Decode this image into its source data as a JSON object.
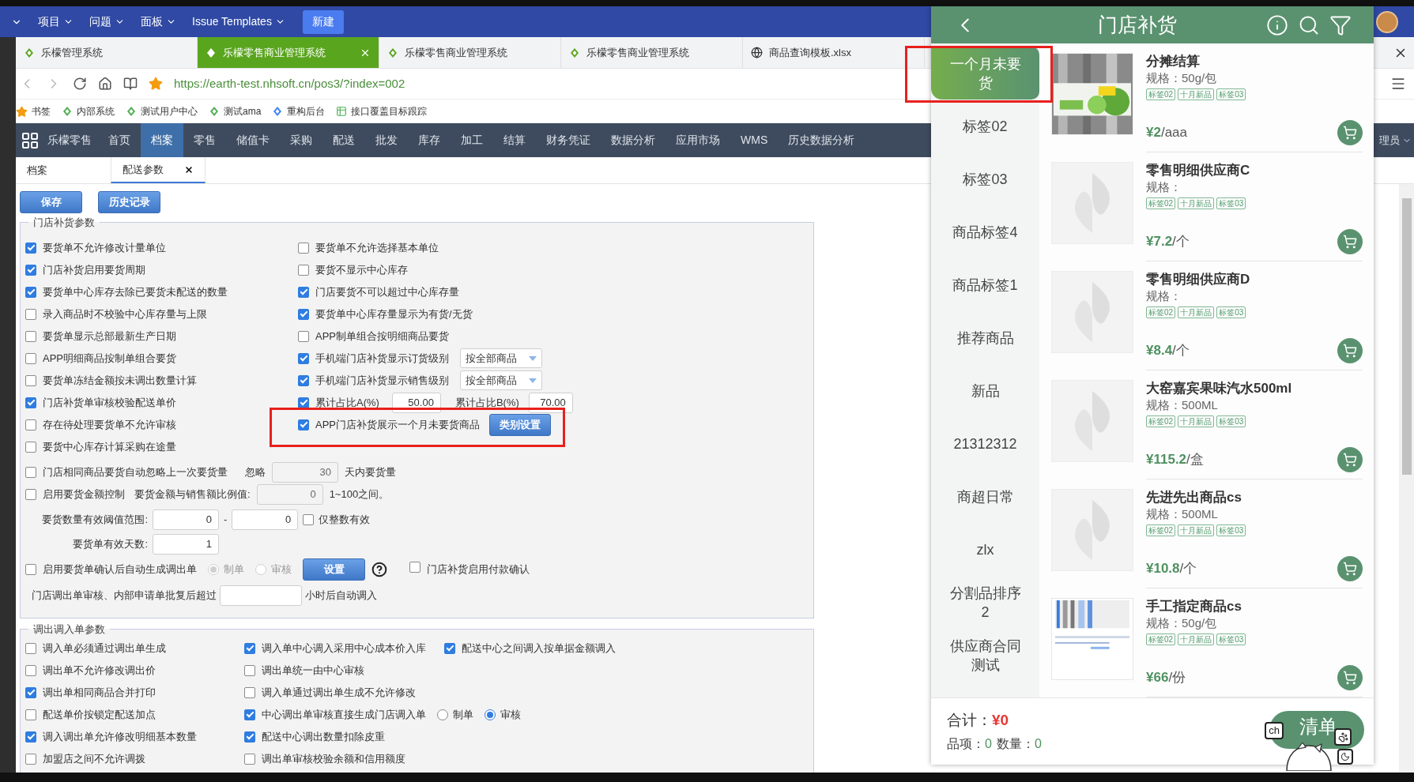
{
  "top_bar": {
    "menus": [
      {
        "label": "项目"
      },
      {
        "label": "问题"
      },
      {
        "label": "面板"
      },
      {
        "label": "Issue Templates"
      }
    ],
    "new_button": "新建"
  },
  "browser_tabs": [
    {
      "title": "乐檬管理系统",
      "selected": false
    },
    {
      "title": "乐檬零售商业管理系统",
      "selected": true
    },
    {
      "title": "乐檬零售商业管理系统",
      "selected": false
    },
    {
      "title": "乐檬零售商业管理系统",
      "selected": false
    },
    {
      "title": "商品查询模板.xlsx",
      "selected": false
    }
  ],
  "address_bar": {
    "url": "https://earth-test.nhsoft.cn/pos3/?index=002"
  },
  "bookmarks": [
    {
      "label": "书签"
    },
    {
      "label": "内部系统"
    },
    {
      "label": "测试用户中心"
    },
    {
      "label": "测试ama"
    },
    {
      "label": "重构后台"
    },
    {
      "label": "接口覆盖目标跟踪"
    }
  ],
  "nav": {
    "brand": "乐檬零售",
    "user": "理员",
    "items": [
      {
        "label": "首页",
        "selected": false
      },
      {
        "label": "档案",
        "selected": true
      },
      {
        "label": "零售",
        "selected": false
      },
      {
        "label": "储值卡",
        "selected": false
      },
      {
        "label": "采购",
        "selected": false
      },
      {
        "label": "配送",
        "selected": false
      },
      {
        "label": "批发",
        "selected": false
      },
      {
        "label": "库存",
        "selected": false
      },
      {
        "label": "加工",
        "selected": false
      },
      {
        "label": "结算",
        "selected": false
      },
      {
        "label": "财务凭证",
        "selected": false
      },
      {
        "label": "数据分析",
        "selected": false
      },
      {
        "label": "应用市场",
        "selected": false
      },
      {
        "label": "WMS",
        "selected": false
      },
      {
        "label": "历史数据分析",
        "selected": false
      }
    ]
  },
  "page_tabs": [
    {
      "label": "档案",
      "selected": false,
      "closable": false
    },
    {
      "label": "配送参数",
      "selected": true,
      "closable": true
    }
  ],
  "actions": [
    "保存",
    "历史记录"
  ],
  "replenish": {
    "title": "门店补货参数",
    "left": [
      {
        "label": "要货单不允许修改计量单位",
        "checked": true
      },
      {
        "label": "门店补货启用要货周期",
        "checked": true
      },
      {
        "label": "要货单中心库存去除已要货未配送的数量",
        "checked": true
      },
      {
        "label": "录入商品时不校验中心库存量与上限",
        "checked": false
      },
      {
        "label": "要货单显示总部最新生产日期",
        "checked": false
      },
      {
        "label": "APP明细商品按制单组合要货",
        "checked": false
      },
      {
        "label": "要货单冻结金额按未调出数量计算",
        "checked": false
      },
      {
        "label": "门店补货单审核校验配送单价",
        "checked": true
      },
      {
        "label": "存在待处理要货单不允许审核",
        "checked": false
      },
      {
        "label": "要货中心库存计算采购在途量",
        "checked": false
      }
    ],
    "right": [
      {
        "kind": "check",
        "label": "要货单不允许选择基本单位",
        "checked": false
      },
      {
        "kind": "check",
        "label": "要货不显示中心库存",
        "checked": false
      },
      {
        "kind": "check",
        "label": "门店要货不可以超过中心库存量",
        "checked": true
      },
      {
        "kind": "check",
        "label": "要货单中心库存量显示为有货/无货",
        "checked": true
      },
      {
        "kind": "check",
        "label": "APP制单组合按明细商品要货",
        "checked": false
      },
      {
        "kind": "select",
        "label": "手机端门店补货显示订货级别",
        "checked": true,
        "value": "按全部商品"
      },
      {
        "kind": "select",
        "label": "手机端门店补货显示销售级别",
        "checked": true,
        "value": "按全部商品"
      },
      {
        "kind": "ratio",
        "label": "累计占比A(%)",
        "checked": true,
        "value": "50.00",
        "label2": "累计占比B(%)",
        "value2": "70.00"
      },
      {
        "kind": "button",
        "label": "APP门店补货展示一个月未要货商品",
        "checked": true,
        "button": "类别设置",
        "highlighted": true
      }
    ],
    "ignore_row": {
      "label": "门店相同商品要货自动忽略上一次要货量",
      "checked": false,
      "prefix": "忽略",
      "value": "30",
      "suffix": "天内要货量"
    },
    "amount_row": {
      "label": "启用要货金额控制",
      "checked": false,
      "ratio_label": "要货金额与销售额比例值:",
      "value": "0",
      "suffix": "1~100之间。"
    },
    "threshold_row": {
      "label": "要货数量有效阈值范围:",
      "min": "0",
      "dash": "-",
      "max": "0",
      "integer_label": "仅整数有效",
      "integer_checked": false
    },
    "days_row": {
      "label": "要货单有效天数:",
      "value": "1"
    },
    "auto_row": {
      "label": "启用要货单确认后自动生成调出单",
      "checked": false,
      "options": [
        {
          "label": "制单",
          "selected": true
        },
        {
          "label": "审核",
          "selected": false
        }
      ],
      "button": "设置",
      "payment_label": "门店补货启用付款确认",
      "payment_checked": false
    },
    "receive_row": {
      "label": "门店调出单审核、内部申请单批复后超过",
      "suffix": "小时后自动调入"
    }
  },
  "transfer": {
    "title": "调出调入单参数",
    "rows": [
      [
        {
          "kind": "check",
          "label": "调入单必须通过调出单生成",
          "checked": false
        },
        {
          "kind": "check",
          "label": "调入单中心调入采用中心成本价入库",
          "checked": true
        },
        {
          "kind": "check",
          "label": "配送中心之间调入按单据金额调入",
          "checked": true
        }
      ],
      [
        {
          "kind": "check",
          "label": "调出单不允许修改调出价",
          "checked": false
        },
        {
          "kind": "check",
          "label": "调出单统一由中心审核",
          "checked": false
        }
      ],
      [
        {
          "kind": "check",
          "label": "调出单相同商品合并打印",
          "checked": true
        },
        {
          "kind": "check",
          "label": "调入单通过调出单生成不允许修改",
          "checked": false
        }
      ],
      [
        {
          "kind": "check",
          "label": "配送单价按锁定配送加点",
          "checked": false
        },
        {
          "kind": "radio",
          "label": "中心调出单审核直接生成门店调入单",
          "checked": true,
          "options": [
            {
              "label": "制单",
              "selected": false
            },
            {
              "label": "审核",
              "selected": true
            }
          ]
        }
      ],
      [
        {
          "kind": "check",
          "label": "调入调出单允许修改明细基本数量",
          "checked": true
        },
        {
          "kind": "check",
          "label": "配送中心调出数量扣除皮重",
          "checked": true
        }
      ],
      [
        {
          "kind": "check",
          "label": "加盟店之间不允许调拨",
          "checked": false
        },
        {
          "kind": "check",
          "label": "调出单审核校验余额和信用额度",
          "checked": false
        }
      ]
    ]
  },
  "app": {
    "title": "门店补货",
    "categories": [
      {
        "label": "一个月未要货",
        "selected": true,
        "highlighted": true
      },
      {
        "label": "标签02",
        "selected": false,
        "highlighted": false
      },
      {
        "label": "标签03",
        "selected": false,
        "highlighted": false
      },
      {
        "label": "商品标签4",
        "selected": false,
        "highlighted": false
      },
      {
        "label": "商品标签1",
        "selected": false,
        "highlighted": false
      },
      {
        "label": "推荐商品",
        "selected": false,
        "highlighted": false
      },
      {
        "label": "新品",
        "selected": false,
        "highlighted": false
      },
      {
        "label": "21312312",
        "selected": false,
        "highlighted": false
      },
      {
        "label": "商超日常",
        "selected": false,
        "highlighted": false
      },
      {
        "label": "zlx",
        "selected": false,
        "highlighted": false
      },
      {
        "label": "分割品排序2",
        "selected": false,
        "highlighted": false
      },
      {
        "label": "供应商合同测试",
        "selected": false,
        "highlighted": false
      }
    ],
    "products": [
      {
        "name": "分摊结算",
        "spec": "规格：50g/包",
        "tags": [
          "标签02",
          "十月新品",
          "标签03"
        ],
        "price": "¥2",
        "unit": "/aaa"
      },
      {
        "name": "零售明细供应商C",
        "spec": "规格：",
        "tags": [
          "标签02",
          "十月新品",
          "标签03"
        ],
        "price": "¥7.2",
        "unit": "/个",
        "kind": "placeholder"
      },
      {
        "name": "零售明细供应商D",
        "spec": "规格：",
        "tags": [
          "标签02",
          "十月新品",
          "标签03"
        ],
        "price": "¥8.4",
        "unit": "/个",
        "kind": "placeholder"
      },
      {
        "name": "大窑嘉宾果味汽水500ml",
        "spec": "规格：500ML",
        "tags": [
          "标签02",
          "十月新品",
          "标签03"
        ],
        "price": "¥115.2",
        "unit": "/盒",
        "kind": "placeholder"
      },
      {
        "name": "先进先出商品cs",
        "spec": "规格：500ML",
        "tags": [
          "标签02",
          "十月新品",
          "标签03"
        ],
        "price": "¥10.8",
        "unit": "/个",
        "kind": "placeholder"
      },
      {
        "name": "手工指定商品cs",
        "spec": "规格：50g/包",
        "tags": [
          "标签02",
          "十月新品",
          "标签03"
        ],
        "price": "¥66",
        "unit": "/份",
        "kind": "screenshot"
      }
    ],
    "footer": {
      "total_label": "合计：",
      "total": "¥0",
      "items_label": "品项：",
      "items": "0",
      "qty_label": "数量：",
      "qty": "0",
      "list_button": "清单"
    },
    "pet_widget": {
      "badge": "ch"
    }
  }
}
